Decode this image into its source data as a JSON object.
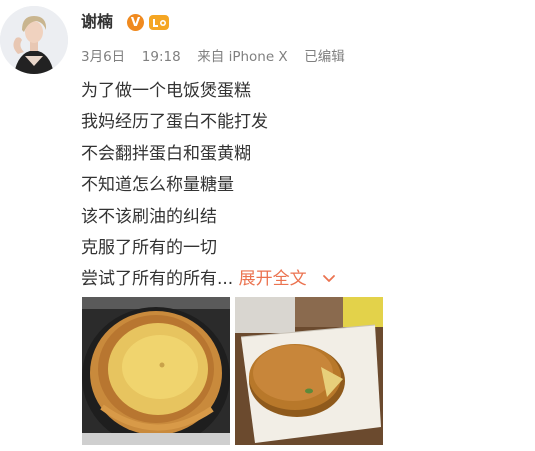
{
  "user": {
    "name": "谢楠",
    "verified_badge": "V",
    "avatar_icon": "user-avatar-photo"
  },
  "meta": {
    "date": "3月6日",
    "time": "19:18",
    "source": "来自 iPhone X",
    "edited": "已编辑"
  },
  "post": {
    "lines": [
      "为了做一个电饭煲蛋糕",
      "我妈经历了蛋白不能打发",
      "不会翻拌蛋白和蛋黄糊",
      "不知道怎么称量糖量",
      "该不该刷油的纠结",
      "克服了所有的一切",
      "尝试了所有的所有..."
    ],
    "expand_label": "展开全文"
  },
  "images": [
    {
      "icon": "cake-in-rice-cooker-photo"
    },
    {
      "icon": "sliced-cake-on-paper-photo"
    }
  ],
  "colors": {
    "link": "#eb7350",
    "name": "#333333",
    "meta": "#808080",
    "verified": "#f08a1f"
  }
}
